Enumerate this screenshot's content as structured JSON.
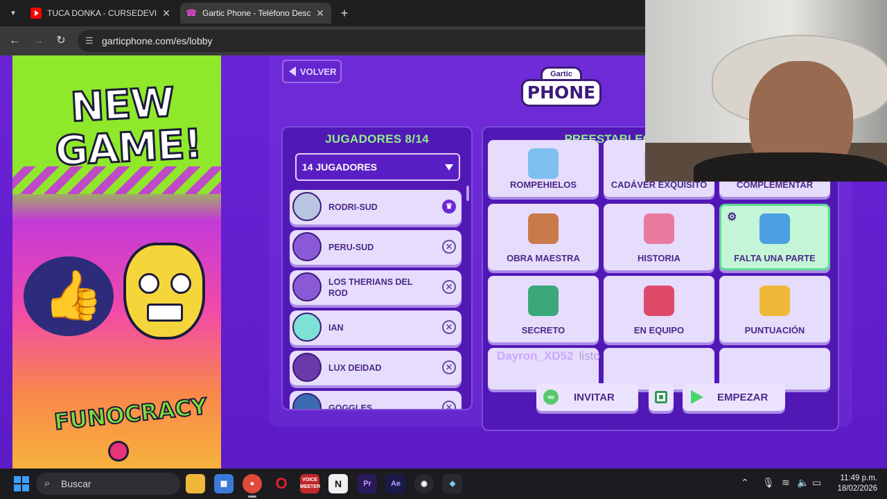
{
  "browser": {
    "tabs": [
      {
        "title": "TUCA DONKA - CURSEDEVIL, D",
        "icon": "youtube-icon"
      },
      {
        "title": "Gartic Phone - Teléfono Descon",
        "icon": "gartic-phone-icon",
        "active": true
      }
    ],
    "url": "garticphone.com/es/lobby"
  },
  "ad": {
    "headline": "NEW GAME!",
    "brand": "FUNOCRACY"
  },
  "lobby": {
    "back_label": "VOLVER",
    "logo_top": "Gartic",
    "logo_main": "PHONE",
    "players": {
      "header": "JUGADORES 8/14",
      "selected_option": "14 JUGADORES",
      "list": [
        {
          "name": "RODRI-SUD",
          "action": "crown-icon",
          "color": "#b8c4e0"
        },
        {
          "name": "PERU-SUD",
          "action": "remove-icon",
          "color": "#8a5ad6"
        },
        {
          "name": "LOS THERIANS DEL ROD",
          "action": "remove-icon",
          "color": "#8a5ad6"
        },
        {
          "name": "IAN",
          "action": "remove-icon",
          "color": "#7ee0d6"
        },
        {
          "name": "LUX DEIDAD",
          "action": "remove-icon",
          "color": "#6a3aa8"
        },
        {
          "name": "GOGGLES",
          "action": "remove-icon",
          "color": "#3a6ab0"
        }
      ]
    },
    "presets": {
      "header": "PREESTABLECIDOS",
      "items": [
        {
          "label": "ROMPEHIELOS",
          "icon": "ice-hammer-icon",
          "color": "#7ec0f0"
        },
        {
          "label": "CADÁVER EXQUISITO",
          "icon": "body-parts-icon",
          "color": "#d8c0f0"
        },
        {
          "label": "COMPLEMENTAR",
          "icon": "puzzle-icon",
          "color": "#d8c0f0"
        },
        {
          "label": "OBRA MAESTRA",
          "icon": "mona-lisa-icon",
          "color": "#c87a4a"
        },
        {
          "label": "HISTORIA",
          "icon": "scroll-feather-icon",
          "color": "#e87aa0"
        },
        {
          "label": "FALTA UNA PARTE",
          "icon": "missing-part-icon",
          "color": "#4aa0e0",
          "selected": true
        },
        {
          "label": "SECRETO",
          "icon": "secret-box-icon",
          "color": "#3aa87a"
        },
        {
          "label": "EN EQUIPO",
          "icon": "team-brush-icon",
          "color": "#e04a6a"
        },
        {
          "label": "PUNTUACIÓN",
          "icon": "medal-icon",
          "color": "#f0b83a"
        }
      ]
    },
    "hint_user": "Dayron_XD52",
    "hint_status": "listo",
    "invite_label": "INVITAR",
    "start_label": "EMPEZAR"
  },
  "taskbar": {
    "search_placeholder": "Buscar",
    "apps": [
      "file-explorer-icon",
      "store-icon",
      "chrome-icon",
      "opera-icon",
      "voicemeeter-icon",
      "notion-icon",
      "premiere-icon",
      "after-effects-icon",
      "obs-icon",
      "app-icon"
    ],
    "time": "11:49 p.m.",
    "date": "18/02/2026"
  }
}
